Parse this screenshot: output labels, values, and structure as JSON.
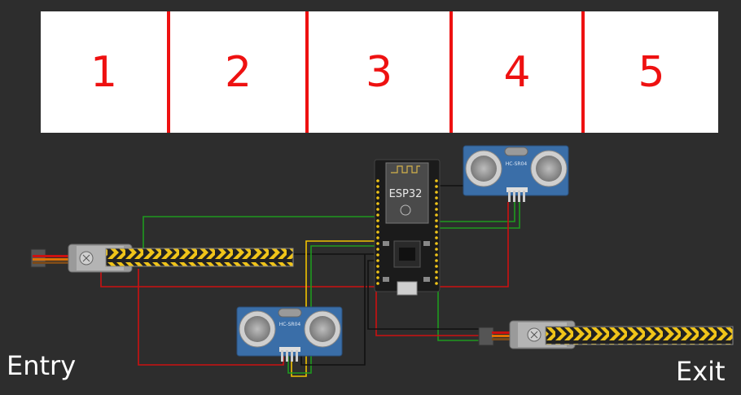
{
  "parking": {
    "slots": [
      "1",
      "2",
      "3",
      "4",
      "5"
    ]
  },
  "labels": {
    "entry": "Entry",
    "exit": "Exit"
  },
  "components": {
    "mcu_label": "ESP32",
    "sensor_label": "HC-SR04"
  },
  "colors": {
    "background": "#2d2d2d",
    "slot_text": "#ee1111",
    "slot_divider": "#ee1111",
    "wire_red": "#cc1111",
    "wire_green": "#1e9a1e",
    "wire_yellow": "#f2c200",
    "wire_black": "#111111",
    "sensor_board": "#3a6ea8",
    "barrier_yellow": "#f0c419"
  }
}
